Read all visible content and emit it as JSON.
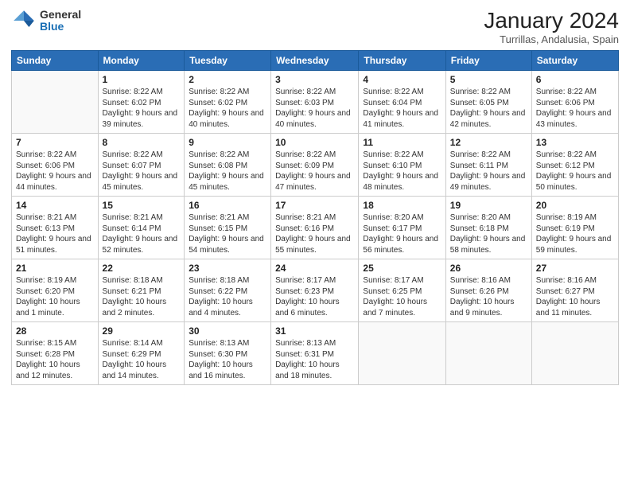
{
  "logo": {
    "general": "General",
    "blue": "Blue"
  },
  "title": "January 2024",
  "subtitle": "Turrillas, Andalusia, Spain",
  "days_header": [
    "Sunday",
    "Monday",
    "Tuesday",
    "Wednesday",
    "Thursday",
    "Friday",
    "Saturday"
  ],
  "weeks": [
    [
      {
        "num": "",
        "sunrise": "",
        "sunset": "",
        "daylight": ""
      },
      {
        "num": "1",
        "sunrise": "Sunrise: 8:22 AM",
        "sunset": "Sunset: 6:02 PM",
        "daylight": "Daylight: 9 hours and 39 minutes."
      },
      {
        "num": "2",
        "sunrise": "Sunrise: 8:22 AM",
        "sunset": "Sunset: 6:02 PM",
        "daylight": "Daylight: 9 hours and 40 minutes."
      },
      {
        "num": "3",
        "sunrise": "Sunrise: 8:22 AM",
        "sunset": "Sunset: 6:03 PM",
        "daylight": "Daylight: 9 hours and 40 minutes."
      },
      {
        "num": "4",
        "sunrise": "Sunrise: 8:22 AM",
        "sunset": "Sunset: 6:04 PM",
        "daylight": "Daylight: 9 hours and 41 minutes."
      },
      {
        "num": "5",
        "sunrise": "Sunrise: 8:22 AM",
        "sunset": "Sunset: 6:05 PM",
        "daylight": "Daylight: 9 hours and 42 minutes."
      },
      {
        "num": "6",
        "sunrise": "Sunrise: 8:22 AM",
        "sunset": "Sunset: 6:06 PM",
        "daylight": "Daylight: 9 hours and 43 minutes."
      }
    ],
    [
      {
        "num": "7",
        "sunrise": "Sunrise: 8:22 AM",
        "sunset": "Sunset: 6:06 PM",
        "daylight": "Daylight: 9 hours and 44 minutes."
      },
      {
        "num": "8",
        "sunrise": "Sunrise: 8:22 AM",
        "sunset": "Sunset: 6:07 PM",
        "daylight": "Daylight: 9 hours and 45 minutes."
      },
      {
        "num": "9",
        "sunrise": "Sunrise: 8:22 AM",
        "sunset": "Sunset: 6:08 PM",
        "daylight": "Daylight: 9 hours and 45 minutes."
      },
      {
        "num": "10",
        "sunrise": "Sunrise: 8:22 AM",
        "sunset": "Sunset: 6:09 PM",
        "daylight": "Daylight: 9 hours and 47 minutes."
      },
      {
        "num": "11",
        "sunrise": "Sunrise: 8:22 AM",
        "sunset": "Sunset: 6:10 PM",
        "daylight": "Daylight: 9 hours and 48 minutes."
      },
      {
        "num": "12",
        "sunrise": "Sunrise: 8:22 AM",
        "sunset": "Sunset: 6:11 PM",
        "daylight": "Daylight: 9 hours and 49 minutes."
      },
      {
        "num": "13",
        "sunrise": "Sunrise: 8:22 AM",
        "sunset": "Sunset: 6:12 PM",
        "daylight": "Daylight: 9 hours and 50 minutes."
      }
    ],
    [
      {
        "num": "14",
        "sunrise": "Sunrise: 8:21 AM",
        "sunset": "Sunset: 6:13 PM",
        "daylight": "Daylight: 9 hours and 51 minutes."
      },
      {
        "num": "15",
        "sunrise": "Sunrise: 8:21 AM",
        "sunset": "Sunset: 6:14 PM",
        "daylight": "Daylight: 9 hours and 52 minutes."
      },
      {
        "num": "16",
        "sunrise": "Sunrise: 8:21 AM",
        "sunset": "Sunset: 6:15 PM",
        "daylight": "Daylight: 9 hours and 54 minutes."
      },
      {
        "num": "17",
        "sunrise": "Sunrise: 8:21 AM",
        "sunset": "Sunset: 6:16 PM",
        "daylight": "Daylight: 9 hours and 55 minutes."
      },
      {
        "num": "18",
        "sunrise": "Sunrise: 8:20 AM",
        "sunset": "Sunset: 6:17 PM",
        "daylight": "Daylight: 9 hours and 56 minutes."
      },
      {
        "num": "19",
        "sunrise": "Sunrise: 8:20 AM",
        "sunset": "Sunset: 6:18 PM",
        "daylight": "Daylight: 9 hours and 58 minutes."
      },
      {
        "num": "20",
        "sunrise": "Sunrise: 8:19 AM",
        "sunset": "Sunset: 6:19 PM",
        "daylight": "Daylight: 9 hours and 59 minutes."
      }
    ],
    [
      {
        "num": "21",
        "sunrise": "Sunrise: 8:19 AM",
        "sunset": "Sunset: 6:20 PM",
        "daylight": "Daylight: 10 hours and 1 minute."
      },
      {
        "num": "22",
        "sunrise": "Sunrise: 8:18 AM",
        "sunset": "Sunset: 6:21 PM",
        "daylight": "Daylight: 10 hours and 2 minutes."
      },
      {
        "num": "23",
        "sunrise": "Sunrise: 8:18 AM",
        "sunset": "Sunset: 6:22 PM",
        "daylight": "Daylight: 10 hours and 4 minutes."
      },
      {
        "num": "24",
        "sunrise": "Sunrise: 8:17 AM",
        "sunset": "Sunset: 6:23 PM",
        "daylight": "Daylight: 10 hours and 6 minutes."
      },
      {
        "num": "25",
        "sunrise": "Sunrise: 8:17 AM",
        "sunset": "Sunset: 6:25 PM",
        "daylight": "Daylight: 10 hours and 7 minutes."
      },
      {
        "num": "26",
        "sunrise": "Sunrise: 8:16 AM",
        "sunset": "Sunset: 6:26 PM",
        "daylight": "Daylight: 10 hours and 9 minutes."
      },
      {
        "num": "27",
        "sunrise": "Sunrise: 8:16 AM",
        "sunset": "Sunset: 6:27 PM",
        "daylight": "Daylight: 10 hours and 11 minutes."
      }
    ],
    [
      {
        "num": "28",
        "sunrise": "Sunrise: 8:15 AM",
        "sunset": "Sunset: 6:28 PM",
        "daylight": "Daylight: 10 hours and 12 minutes."
      },
      {
        "num": "29",
        "sunrise": "Sunrise: 8:14 AM",
        "sunset": "Sunset: 6:29 PM",
        "daylight": "Daylight: 10 hours and 14 minutes."
      },
      {
        "num": "30",
        "sunrise": "Sunrise: 8:13 AM",
        "sunset": "Sunset: 6:30 PM",
        "daylight": "Daylight: 10 hours and 16 minutes."
      },
      {
        "num": "31",
        "sunrise": "Sunrise: 8:13 AM",
        "sunset": "Sunset: 6:31 PM",
        "daylight": "Daylight: 10 hours and 18 minutes."
      },
      {
        "num": "",
        "sunrise": "",
        "sunset": "",
        "daylight": ""
      },
      {
        "num": "",
        "sunrise": "",
        "sunset": "",
        "daylight": ""
      },
      {
        "num": "",
        "sunrise": "",
        "sunset": "",
        "daylight": ""
      }
    ]
  ]
}
